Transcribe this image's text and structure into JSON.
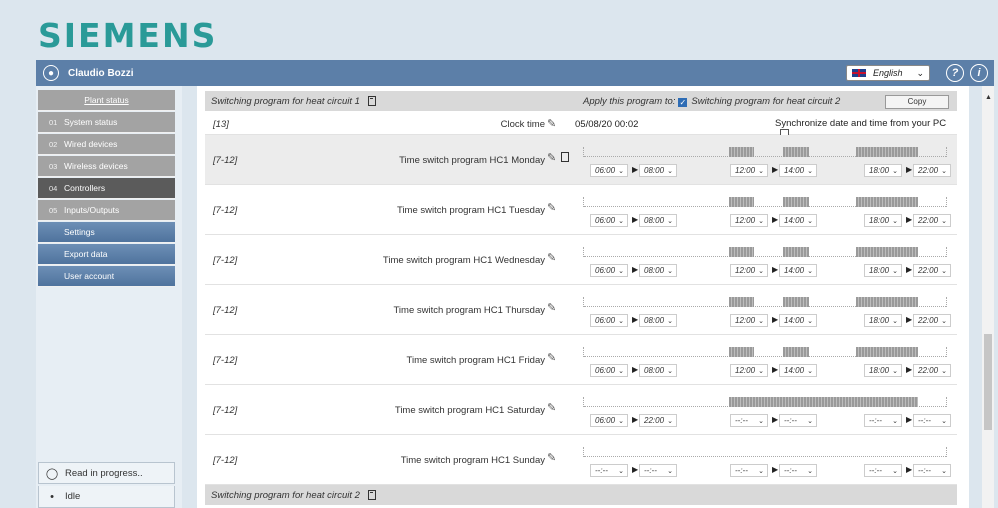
{
  "brand": {
    "logo": "SIEMENS",
    "accent": "#2a9a98",
    "bar_color": "#5c7fa8"
  },
  "user": {
    "name": "Claudio Bozzi",
    "icon": "user-icon"
  },
  "language": {
    "selected": "English"
  },
  "sidebar": {
    "items": [
      {
        "num": "",
        "label": "Plant status"
      },
      {
        "num": "01",
        "label": "System status"
      },
      {
        "num": "02",
        "label": "Wired devices"
      },
      {
        "num": "03",
        "label": "Wireless devices"
      },
      {
        "num": "04",
        "label": "Controllers"
      },
      {
        "num": "05",
        "label": "Inputs/Outputs"
      },
      {
        "num": "",
        "label": "Settings"
      },
      {
        "num": "",
        "label": "Export data"
      },
      {
        "num": "",
        "label": "User account"
      }
    ],
    "status": [
      {
        "icon": "spinner-icon",
        "text": "Read in progress.."
      },
      {
        "icon": "signal-icon",
        "text": "Idle"
      }
    ]
  },
  "section1": {
    "title": "Switching program for heat circuit 1",
    "apply_label": "Apply this program to:",
    "apply_target": "Switching program for heat circuit 2",
    "copy_label": "Copy"
  },
  "clock": {
    "range": "[13]",
    "name": "Clock time",
    "value": "05/08/20 00:02",
    "sync_label": "Synchronize date and time from your PC"
  },
  "programs": [
    {
      "range": "[7-12]",
      "name": "Time switch program HC1 Monday",
      "times": [
        "06:00",
        "08:00",
        "12:00",
        "14:00",
        "18:00",
        "22:00"
      ],
      "bars": [
        [
          0.4,
          0.47
        ],
        [
          0.55,
          0.62
        ],
        [
          0.75,
          0.92
        ]
      ]
    },
    {
      "range": "[7-12]",
      "name": "Time switch program HC1 Tuesday",
      "times": [
        "06:00",
        "08:00",
        "12:00",
        "14:00",
        "18:00",
        "22:00"
      ],
      "bars": [
        [
          0.4,
          0.47
        ],
        [
          0.55,
          0.62
        ],
        [
          0.75,
          0.92
        ]
      ]
    },
    {
      "range": "[7-12]",
      "name": "Time switch program HC1 Wednesday",
      "times": [
        "06:00",
        "08:00",
        "12:00",
        "14:00",
        "18:00",
        "22:00"
      ],
      "bars": [
        [
          0.4,
          0.47
        ],
        [
          0.55,
          0.62
        ],
        [
          0.75,
          0.92
        ]
      ]
    },
    {
      "range": "[7-12]",
      "name": "Time switch program HC1 Thursday",
      "times": [
        "06:00",
        "08:00",
        "12:00",
        "14:00",
        "18:00",
        "22:00"
      ],
      "bars": [
        [
          0.4,
          0.47
        ],
        [
          0.55,
          0.62
        ],
        [
          0.75,
          0.92
        ]
      ]
    },
    {
      "range": "[7-12]",
      "name": "Time switch program HC1 Friday",
      "times": [
        "06:00",
        "08:00",
        "12:00",
        "14:00",
        "18:00",
        "22:00"
      ],
      "bars": [
        [
          0.4,
          0.47
        ],
        [
          0.55,
          0.62
        ],
        [
          0.75,
          0.92
        ]
      ]
    },
    {
      "range": "[7-12]",
      "name": "Time switch program HC1 Saturday",
      "times": [
        "06:00",
        "22:00",
        "--:--",
        "--:--",
        "--:--",
        "--:--"
      ],
      "bars": [
        [
          0.4,
          0.92
        ]
      ]
    },
    {
      "range": "[7-12]",
      "name": "Time switch program HC1 Sunday",
      "times": [
        "--:--",
        "--:--",
        "--:--",
        "--:--",
        "--:--",
        "--:--"
      ],
      "bars": []
    }
  ],
  "section2": {
    "title": "Switching program for heat circuit 2"
  }
}
